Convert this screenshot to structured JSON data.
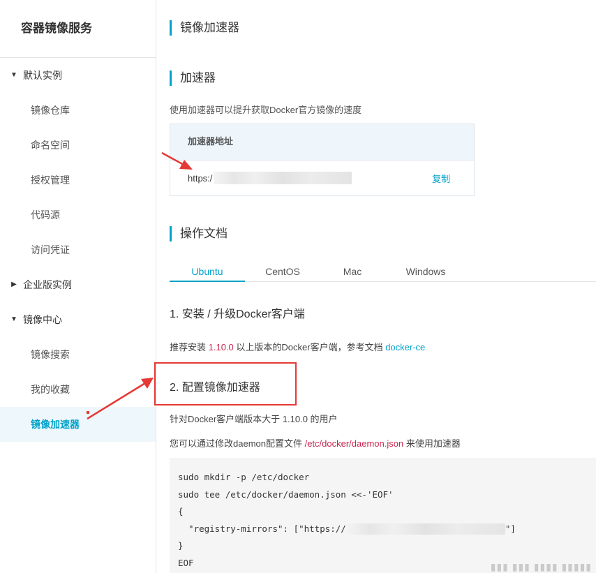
{
  "sidebar": {
    "title": "容器镜像服务",
    "groups": [
      {
        "label": "默认实例",
        "expanded": true,
        "items": [
          "镜像仓库",
          "命名空间",
          "授权管理",
          "代码源",
          "访问凭证"
        ]
      },
      {
        "label": "企业版实例",
        "expanded": false,
        "items": []
      },
      {
        "label": "镜像中心",
        "expanded": true,
        "items": [
          "镜像搜索",
          "我的收藏",
          "镜像加速器"
        ],
        "active": "镜像加速器"
      }
    ]
  },
  "page": {
    "title": "镜像加速器",
    "accelerator": {
      "heading": "加速器",
      "description": "使用加速器可以提升获取Docker官方镜像的速度",
      "table_header": "加速器地址",
      "address_prefix": "https:/",
      "copy_label": "复制"
    },
    "docs": {
      "heading": "操作文档",
      "tabs": [
        "Ubuntu",
        "CentOS",
        "Mac",
        "Windows"
      ],
      "active_tab": "Ubuntu",
      "step1_title": "1. 安装 / 升级Docker客户端",
      "step1_text_a": "推荐安装 ",
      "step1_version": "1.10.0",
      "step1_text_b": " 以上版本的Docker客户端，参考文档 ",
      "step1_link": "docker-ce",
      "step2_title": "2. 配置镜像加速器",
      "step2_text1": "针对Docker客户端版本大于 1.10.0 的用户",
      "step2_text2_a": "您可以通过修改daemon配置文件 ",
      "step2_text2_path": "/etc/docker/daemon.json",
      "step2_text2_b": " 来使用加速器",
      "code_lines": [
        "sudo mkdir -p /etc/docker",
        "sudo tee /etc/docker/daemon.json <<-'EOF'",
        "{",
        "  \"registry-mirrors\": [\"https://",
        "}",
        "EOF"
      ],
      "code_line4_suffix": "\"]"
    }
  },
  "colors": {
    "accent": "#00a2ca",
    "highlight_red": "#c7254e",
    "annotation_red": "#e53935",
    "active_bg": "#eef7fb"
  }
}
